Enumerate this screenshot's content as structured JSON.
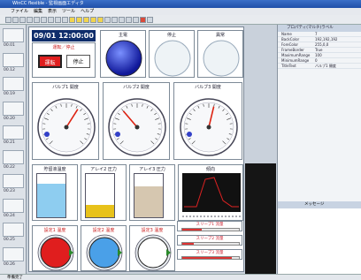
{
  "window": {
    "title": "WinCC flexible - 監視画面エディタ"
  },
  "menu": [
    "ファイル",
    "編集",
    "表示",
    "ツール",
    "ヘルプ"
  ],
  "clock": {
    "text": "09/01 12:00:00"
  },
  "run_panel": {
    "title": "運転／停止",
    "run_label": "運転",
    "stop_label": "停止"
  },
  "top_panels": [
    {
      "title": "主電"
    },
    {
      "title": "停止"
    },
    {
      "title": "異常"
    }
  ],
  "gauges": [
    {
      "title": "バルブ1 開度",
      "value_fraction": 0.62
    },
    {
      "title": "バルブ2 開度",
      "value_fraction": 0.35
    },
    {
      "title": "バルブ3 開度",
      "value_fraction": 0.55
    }
  ],
  "tanks": [
    {
      "title": "貯留液温度",
      "level_fraction": 0.78,
      "color": "#8ecdf0"
    },
    {
      "title": "アレイ2 圧力",
      "level_fraction": 0.28,
      "color": "#e8c21a"
    },
    {
      "title": "アレイ3 圧力",
      "level_fraction": 0.72,
      "color": "#d6c7b0"
    }
  ],
  "trend": {
    "title": "傾向"
  },
  "knobs": [
    {
      "title": "設定1 温度",
      "color": "#e01e1e"
    },
    {
      "title": "設定2 温度",
      "color": "#4aa0e8"
    },
    {
      "title": "設定3 温度",
      "color": "#ffffff"
    }
  ],
  "sliders": [
    {
      "title": "スリーブ1 流量",
      "value_fraction": 0.35
    },
    {
      "title": "スリーブ2 流量",
      "value_fraction": 0.2
    },
    {
      "title": "スリーブ3 流量",
      "value_fraction": 0.88
    }
  ],
  "left_thumbs": [
    {
      "label": "00.01"
    },
    {
      "label": "00.12"
    },
    {
      "label": "00.19"
    },
    {
      "label": "00.20"
    },
    {
      "label": "00.21"
    },
    {
      "label": "00.22"
    },
    {
      "label": "00.23"
    },
    {
      "label": "00.24"
    },
    {
      "label": "00.25"
    },
    {
      "label": "00.26"
    }
  ],
  "properties": {
    "header": "プロパティ(マルチ)ラベル",
    "rows": [
      {
        "key": "Name",
        "value": "7"
      },
      {
        "key": "BackColor",
        "value": "192,192,192"
      },
      {
        "key": "ForeColor",
        "value": "255,0,0"
      },
      {
        "key": "FrameBorder",
        "value": "True"
      },
      {
        "key": "MaximumRange",
        "value": "100"
      },
      {
        "key": "MinimumRange",
        "value": "0"
      },
      {
        "key": "TitleText",
        "value": "バルブ1 開度"
      }
    ]
  },
  "bottom_pane": {
    "header": "メッセージ"
  },
  "status": {
    "text": "準備完了"
  }
}
